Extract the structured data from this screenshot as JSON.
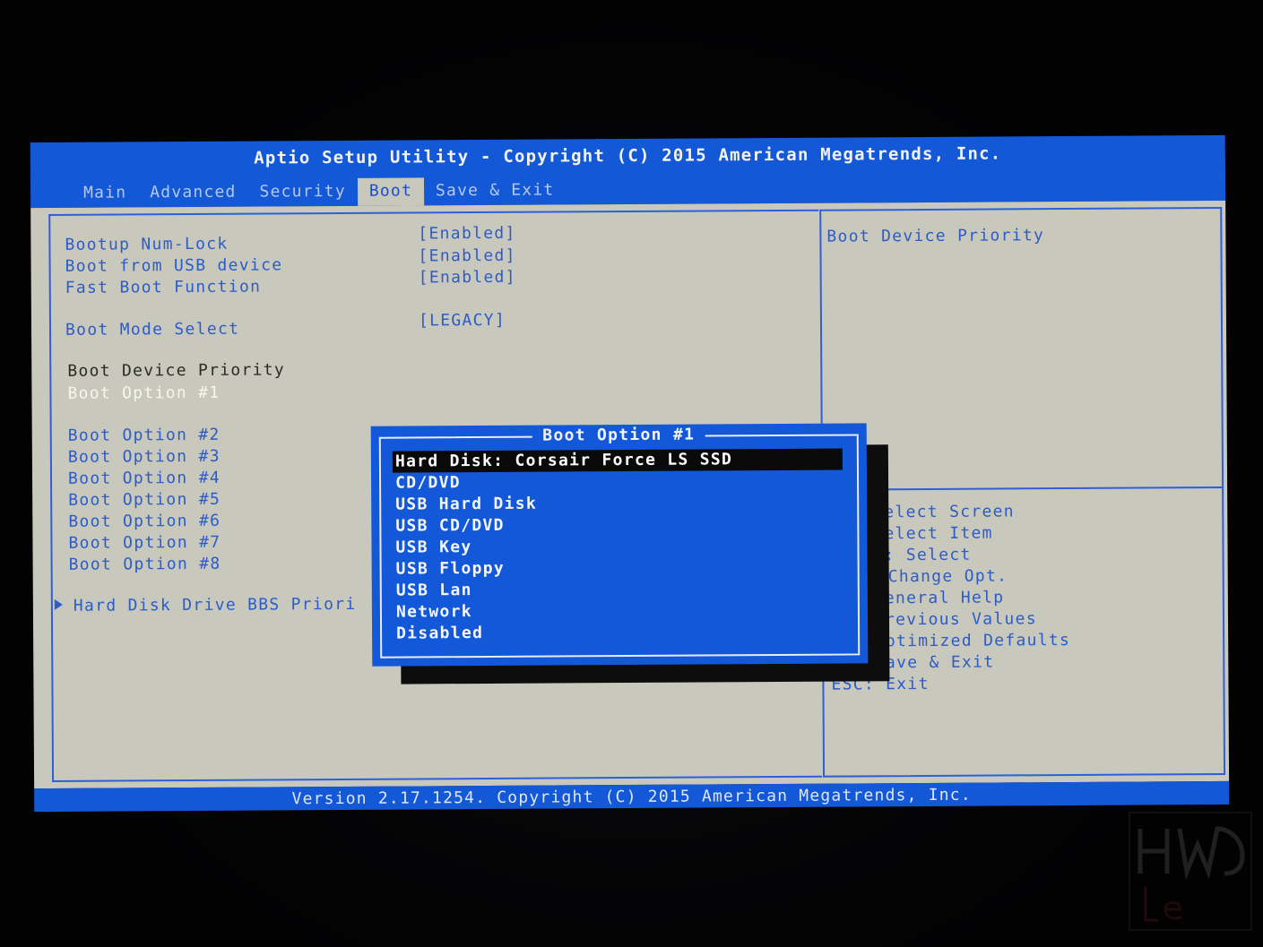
{
  "header": {
    "title": "Aptio Setup Utility - Copyright (C) 2015 American Megatrends, Inc."
  },
  "tabs": [
    {
      "label": "Main",
      "active": false
    },
    {
      "label": "Advanced",
      "active": false
    },
    {
      "label": "Security",
      "active": false
    },
    {
      "label": "Boot",
      "active": true
    },
    {
      "label": "Save & Exit",
      "active": false
    }
  ],
  "settings": [
    {
      "label": "Bootup Num-Lock",
      "value": "[Enabled]"
    },
    {
      "label": "Boot from USB device",
      "value": "[Enabled]"
    },
    {
      "label": "Fast Boot Function",
      "value": "[Enabled]"
    },
    {
      "label": "Boot Mode Select",
      "value": "[LEGACY]"
    }
  ],
  "boot_priority": {
    "heading": "Boot Device Priority",
    "options": [
      "Boot Option #1",
      "Boot Option #2",
      "Boot Option #3",
      "Boot Option #4",
      "Boot Option #5",
      "Boot Option #6",
      "Boot Option #7",
      "Boot Option #8"
    ],
    "submenu": "Hard Disk Drive BBS Priori"
  },
  "help_panel": {
    "title": "Boot Device Priority",
    "keys": [
      "elect Screen",
      "elect Item",
      ": Select",
      "Change Opt.",
      "eneral Help",
      "revious Values",
      "F3: Optimized Defaults",
      "F4: Save & Exit",
      "ESC: Exit"
    ]
  },
  "popup": {
    "title": "Boot Option #1",
    "options": [
      "Hard Disk: Corsair Force LS SSD",
      "CD/DVD",
      "USB Hard Disk",
      "USB CD/DVD",
      "USB Key",
      "USB Floppy",
      "USB Lan",
      "Network",
      "Disabled"
    ],
    "selected_index": 0
  },
  "footer": {
    "text": "Version 2.17.1254. Copyright (C) 2015 American Megatrends, Inc."
  },
  "colors": {
    "bios_blue": "#1358d6",
    "panel_gray": "#c9c8bc",
    "label_blue": "#2c5cc8",
    "selected_bg": "#0a0a0a"
  }
}
